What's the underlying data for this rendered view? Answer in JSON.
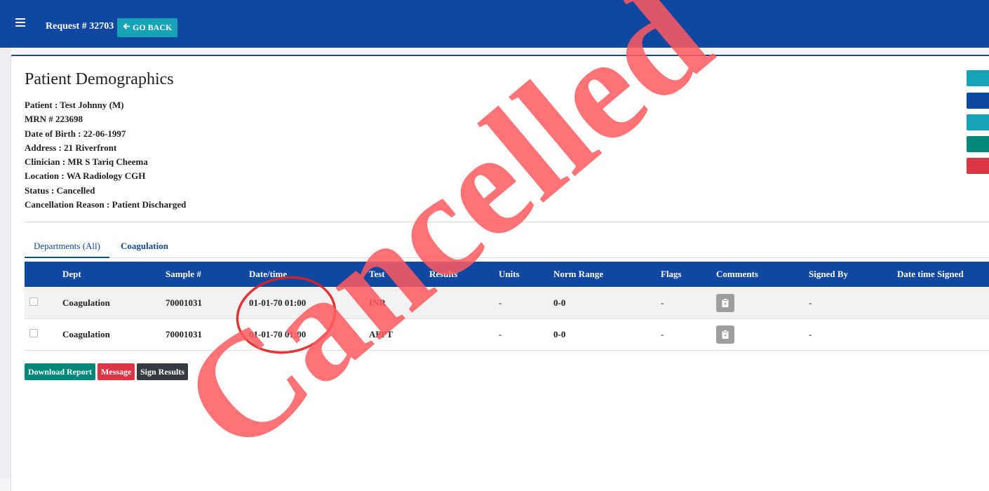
{
  "header": {
    "request_title": "Request # 32703",
    "go_back_label": "GO BACK"
  },
  "demographics": {
    "title": "Patient Demographics",
    "patient": "Patient : Test Johnny (M)",
    "mrn": "MRN # 223698",
    "dob": "Date of Birth : 22-06-1997",
    "address": "Address : 21 Riverfront",
    "clinician": "Clinician : MR S Tariq Cheema",
    "location": "Location : WA Radiology CGH",
    "status": "Status : Cancelled",
    "cancellation_reason": "Cancellation Reason : Patient Discharged"
  },
  "side_buttons": [
    {
      "color": "#17a2b8"
    },
    {
      "color": "#0f47a1"
    },
    {
      "color": "#17a2b8"
    },
    {
      "color": "#00897b"
    },
    {
      "color": "#dc3545"
    }
  ],
  "tabs": [
    {
      "label": "Departments (All)",
      "active": true
    },
    {
      "label": "Coagulation",
      "active": false
    }
  ],
  "table": {
    "columns": [
      "Dept",
      "Sample #",
      "Date/time",
      "Test",
      "Results",
      "Units",
      "Norm Range",
      "Flags",
      "Comments",
      "Signed By",
      "Date time Signed"
    ],
    "rows": [
      {
        "dept": "Coagulation",
        "sample": "70001031",
        "datetime": "01-01-70 01:00",
        "test": "INR",
        "results": "-",
        "units": "",
        "norm_range": "0-0",
        "flags": "-",
        "signed_by": "-",
        "date_signed": ""
      },
      {
        "dept": "Coagulation",
        "sample": "70001031",
        "datetime": "01-01-70 01:00",
        "test": "APPT",
        "results": "-",
        "units": "",
        "norm_range": "0-0",
        "flags": "-",
        "signed_by": "-",
        "date_signed": ""
      }
    ]
  },
  "actions": {
    "download_label": "Download Report",
    "message_label": "Message",
    "sign_label": "Sign Results"
  },
  "overlay": {
    "stamp_text": "Cancelled",
    "stamp_color": "#ff5a5f",
    "circle_color": "#e02020"
  },
  "colors": {
    "primary": "#0f47a1",
    "info": "#17a2b8",
    "success": "#00897b",
    "danger": "#dc3545",
    "dark": "#343a40"
  }
}
